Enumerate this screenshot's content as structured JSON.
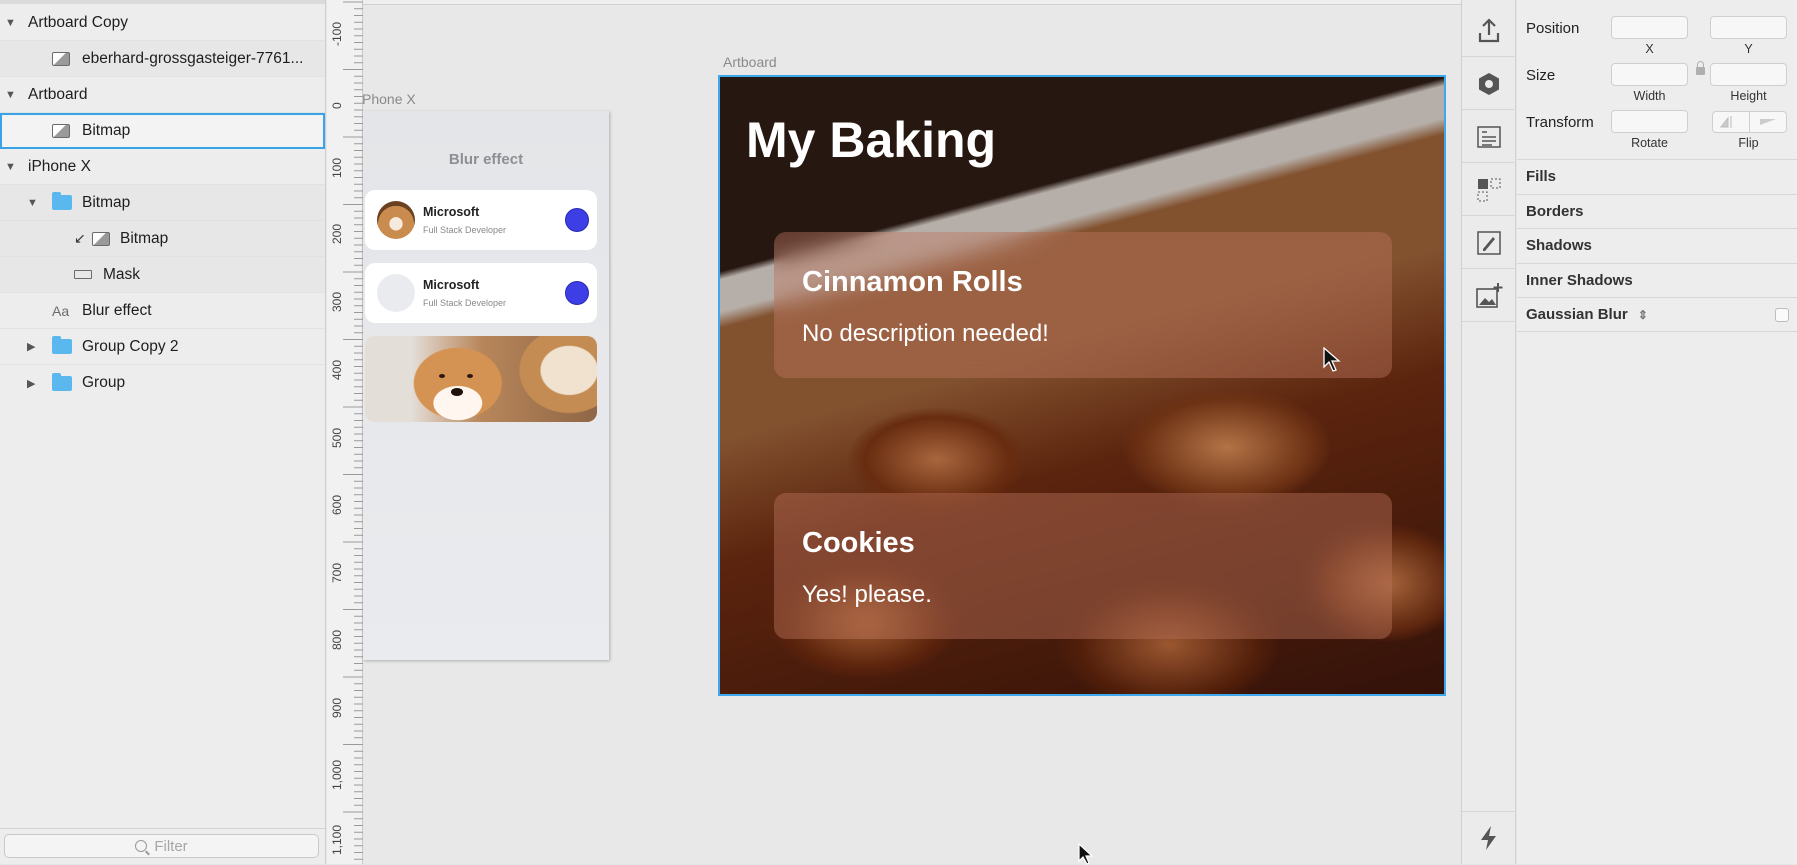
{
  "layers": {
    "items": [
      {
        "label": "Artboard Copy",
        "kind": "artboard"
      },
      {
        "label": "eberhard-grossgasteiger-7761...",
        "kind": "bitmap"
      },
      {
        "label": "Artboard",
        "kind": "artboard"
      },
      {
        "label": "Bitmap",
        "kind": "bitmap",
        "selected": true
      },
      {
        "label": "iPhone X",
        "kind": "artboard"
      },
      {
        "label": "Bitmap",
        "kind": "group"
      },
      {
        "label": "Bitmap",
        "kind": "bitmap-masked"
      },
      {
        "label": "Mask",
        "kind": "mask"
      },
      {
        "label": "Blur effect",
        "kind": "text"
      },
      {
        "label": "Group Copy 2",
        "kind": "group"
      },
      {
        "label": "Group",
        "kind": "group"
      }
    ],
    "text_icon": "Aa",
    "filter_placeholder": "Filter"
  },
  "ruler": {
    "labels": [
      "-100",
      "0",
      "100",
      "200",
      "300",
      "400",
      "500",
      "600",
      "700",
      "800",
      "900",
      "1,000",
      "1,100"
    ]
  },
  "canvas": {
    "phone": {
      "label": "Phone X",
      "title": "Blur effect",
      "cards": [
        {
          "name": "Microsoft",
          "role": "Full Stack Developer",
          "avatar": "dog-avatar"
        },
        {
          "name": "Microsoft",
          "role": "Full Stack Developer",
          "avatar": "empty-avatar"
        }
      ],
      "dot_color": "#3e3ee6"
    },
    "artboard": {
      "label": "Artboard",
      "title": "My Baking",
      "cards": [
        {
          "title": "Cinnamon Rolls",
          "description": "No description needed!"
        },
        {
          "title": "Cookies",
          "description": "Yes! please."
        }
      ],
      "selection_color": "#3ea8ee"
    }
  },
  "tools": [
    "export-icon",
    "symbol-icon",
    "text-style-icon",
    "layout-icon",
    "edit-path-icon",
    "insert-image-icon",
    "bolt-icon"
  ],
  "inspector": {
    "position": {
      "label": "Position",
      "x_label": "X",
      "y_label": "Y"
    },
    "size": {
      "label": "Size",
      "w_label": "Width",
      "h_label": "Height"
    },
    "transform": {
      "label": "Transform",
      "rotate_label": "Rotate",
      "flip_label": "Flip"
    },
    "sections": [
      "Fills",
      "Borders",
      "Shadows",
      "Inner Shadows",
      "Gaussian Blur"
    ]
  }
}
